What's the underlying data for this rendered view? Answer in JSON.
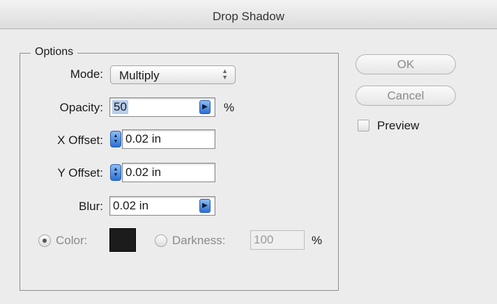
{
  "window": {
    "title": "Drop Shadow"
  },
  "options": {
    "group_label": "Options",
    "mode": {
      "label": "Mode:",
      "value": "Multiply"
    },
    "opacity": {
      "label": "Opacity:",
      "value": "50",
      "unit": "%"
    },
    "x_offset": {
      "label": "X Offset:",
      "value": "0.02 in"
    },
    "y_offset": {
      "label": "Y Offset:",
      "value": "0.02 in"
    },
    "blur": {
      "label": "Blur:",
      "value": "0.02 in"
    },
    "color": {
      "label": "Color:",
      "selected": true,
      "swatch": "#1c1c1c"
    },
    "darkness": {
      "label": "Darkness:",
      "value": "100",
      "unit": "%",
      "selected": false
    }
  },
  "buttons": {
    "ok": "OK",
    "cancel": "Cancel"
  },
  "preview": {
    "label": "Preview",
    "checked": false
  }
}
